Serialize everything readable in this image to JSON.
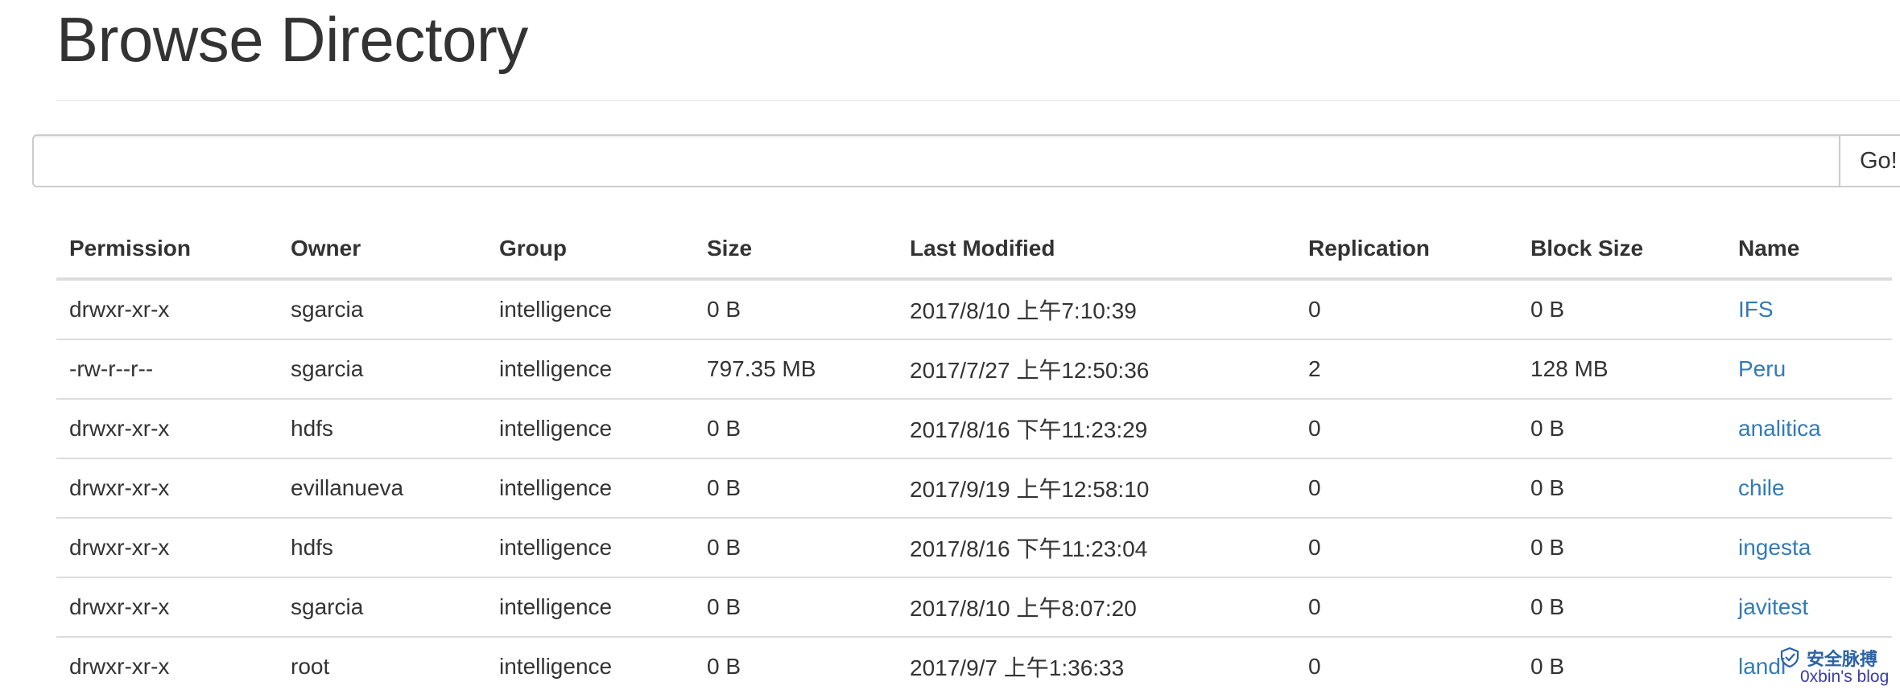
{
  "page": {
    "title": "Browse Directory"
  },
  "search": {
    "value": "",
    "placeholder": "",
    "go_label": "Go!"
  },
  "table": {
    "headers": {
      "permission": "Permission",
      "owner": "Owner",
      "group": "Group",
      "size": "Size",
      "last_modified": "Last Modified",
      "replication": "Replication",
      "block_size": "Block Size",
      "name": "Name"
    },
    "rows": [
      {
        "permission": "drwxr-xr-x",
        "owner": "sgarcia",
        "group": "intelligence",
        "size": "0 B",
        "last_modified": "2017/8/10 上午7:10:39",
        "replication": "0",
        "block_size": "0 B",
        "name": "IFS"
      },
      {
        "permission": "-rw-r--r--",
        "owner": "sgarcia",
        "group": "intelligence",
        "size": "797.35 MB",
        "last_modified": "2017/7/27 上午12:50:36",
        "replication": "2",
        "block_size": "128 MB",
        "name": "Peru"
      },
      {
        "permission": "drwxr-xr-x",
        "owner": "hdfs",
        "group": "intelligence",
        "size": "0 B",
        "last_modified": "2017/8/16 下午11:23:29",
        "replication": "0",
        "block_size": "0 B",
        "name": "analitica"
      },
      {
        "permission": "drwxr-xr-x",
        "owner": "evillanueva",
        "group": "intelligence",
        "size": "0 B",
        "last_modified": "2017/9/19 上午12:58:10",
        "replication": "0",
        "block_size": "0 B",
        "name": "chile"
      },
      {
        "permission": "drwxr-xr-x",
        "owner": "hdfs",
        "group": "intelligence",
        "size": "0 B",
        "last_modified": "2017/8/16 下午11:23:04",
        "replication": "0",
        "block_size": "0 B",
        "name": "ingesta"
      },
      {
        "permission": "drwxr-xr-x",
        "owner": "sgarcia",
        "group": "intelligence",
        "size": "0 B",
        "last_modified": "2017/8/10 上午8:07:20",
        "replication": "0",
        "block_size": "0 B",
        "name": "javitest"
      },
      {
        "permission": "drwxr-xr-x",
        "owner": "root",
        "group": "intelligence",
        "size": "0 B",
        "last_modified": "2017/9/7 上午1:36:33",
        "replication": "0",
        "block_size": "0 B",
        "name": "landi"
      }
    ]
  },
  "watermark": {
    "logo_text": "安全脉搏",
    "blog_text": "0xbin's blog"
  },
  "colors": {
    "link": "#337ab7",
    "text": "#333333",
    "border": "#dddddd"
  }
}
